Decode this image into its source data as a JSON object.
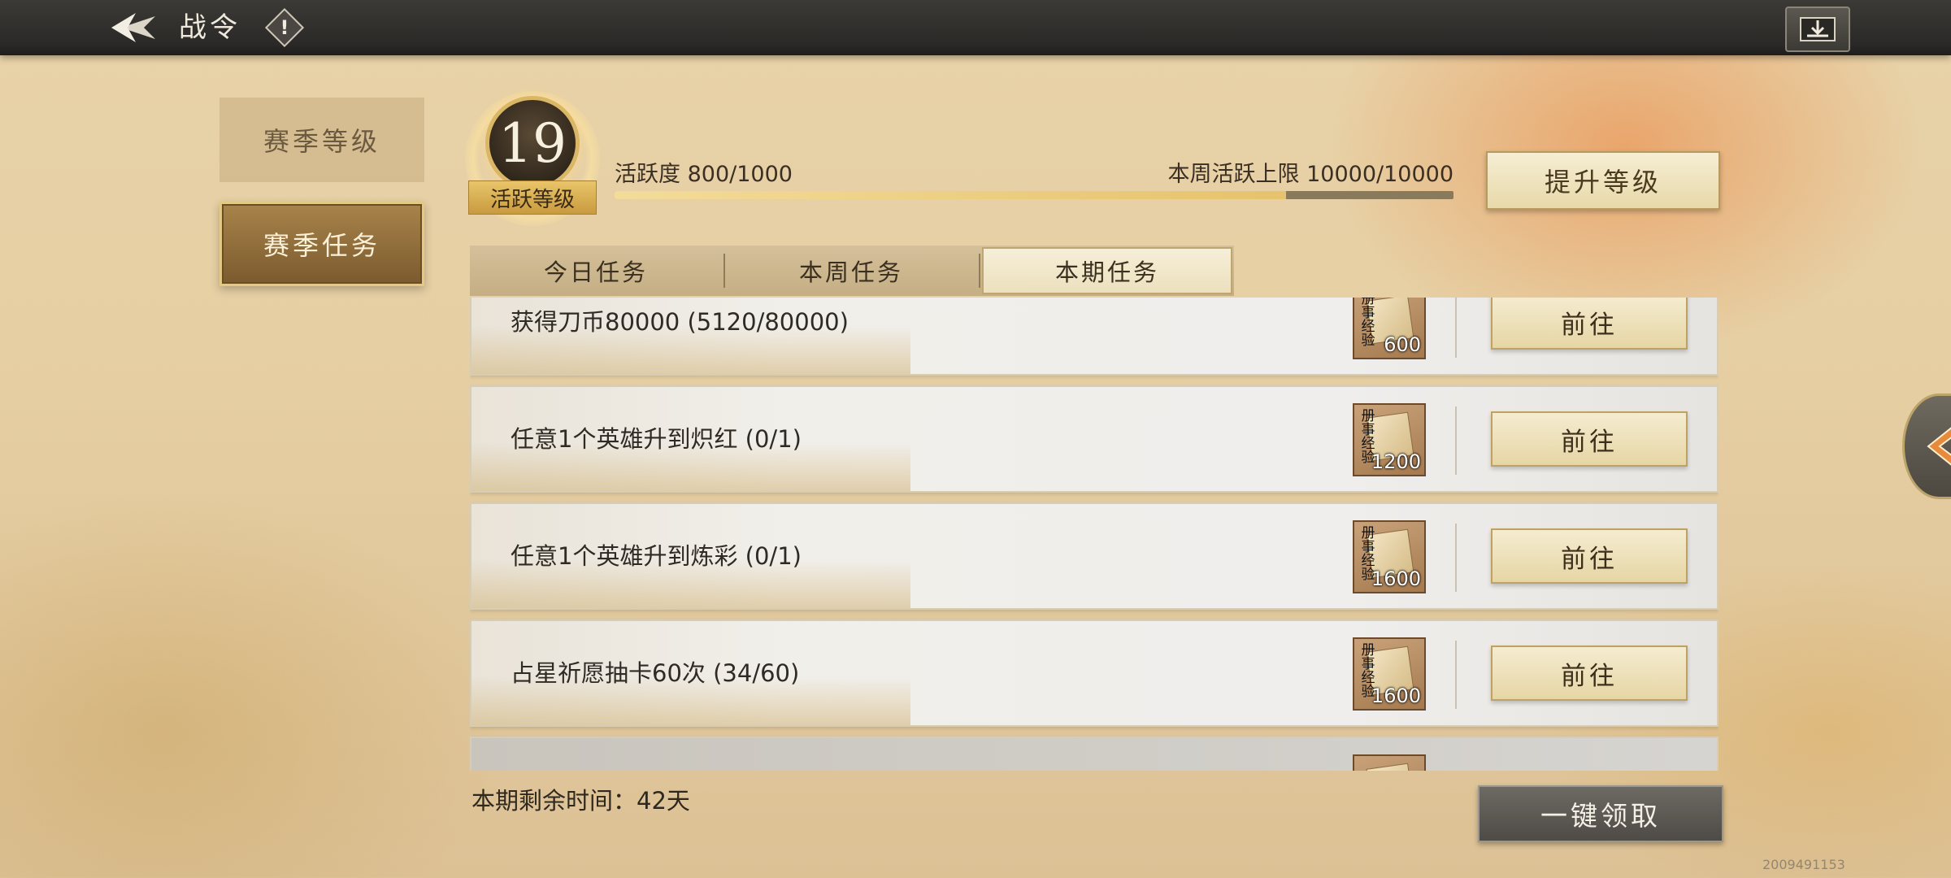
{
  "header": {
    "title": "战令",
    "info_mark": "!"
  },
  "sidebar": {
    "items": [
      {
        "label": "赛季等级"
      },
      {
        "label": "赛季任务"
      }
    ]
  },
  "level": {
    "value": "19",
    "label": "活跃等级"
  },
  "activity": {
    "text": "活跃度 800/1000",
    "weekly_text": "本周活跃上限 10000/10000",
    "progress": 0.8
  },
  "upgrade_button": "提升等级",
  "tabs": [
    {
      "label": "今日任务"
    },
    {
      "label": "本周任务"
    },
    {
      "label": "本期任务"
    }
  ],
  "tasks": [
    {
      "text": "获得刀币80000 (5120/80000)",
      "reward_tag": "册事经验",
      "reward": "600",
      "button": "前往"
    },
    {
      "text": "任意1个英雄升到炽红 (0/1)",
      "reward_tag": "册事经验",
      "reward": "1200",
      "button": "前往"
    },
    {
      "text": "任意1个英雄升到炼彩 (0/1)",
      "reward_tag": "册事经验",
      "reward": "1600",
      "button": "前往"
    },
    {
      "text": "占星祈愿抽卡60次 (34/60)",
      "reward_tag": "册事经验",
      "reward": "1600",
      "button": "前往"
    }
  ],
  "remaining": "本期剩余时间：42天",
  "claim_button": "一键领取",
  "uid": "2009491153",
  "colors": {
    "accent_gold": "#d9b766",
    "active_tab": "#8b6a38",
    "claim_gray": "#5c5954"
  }
}
